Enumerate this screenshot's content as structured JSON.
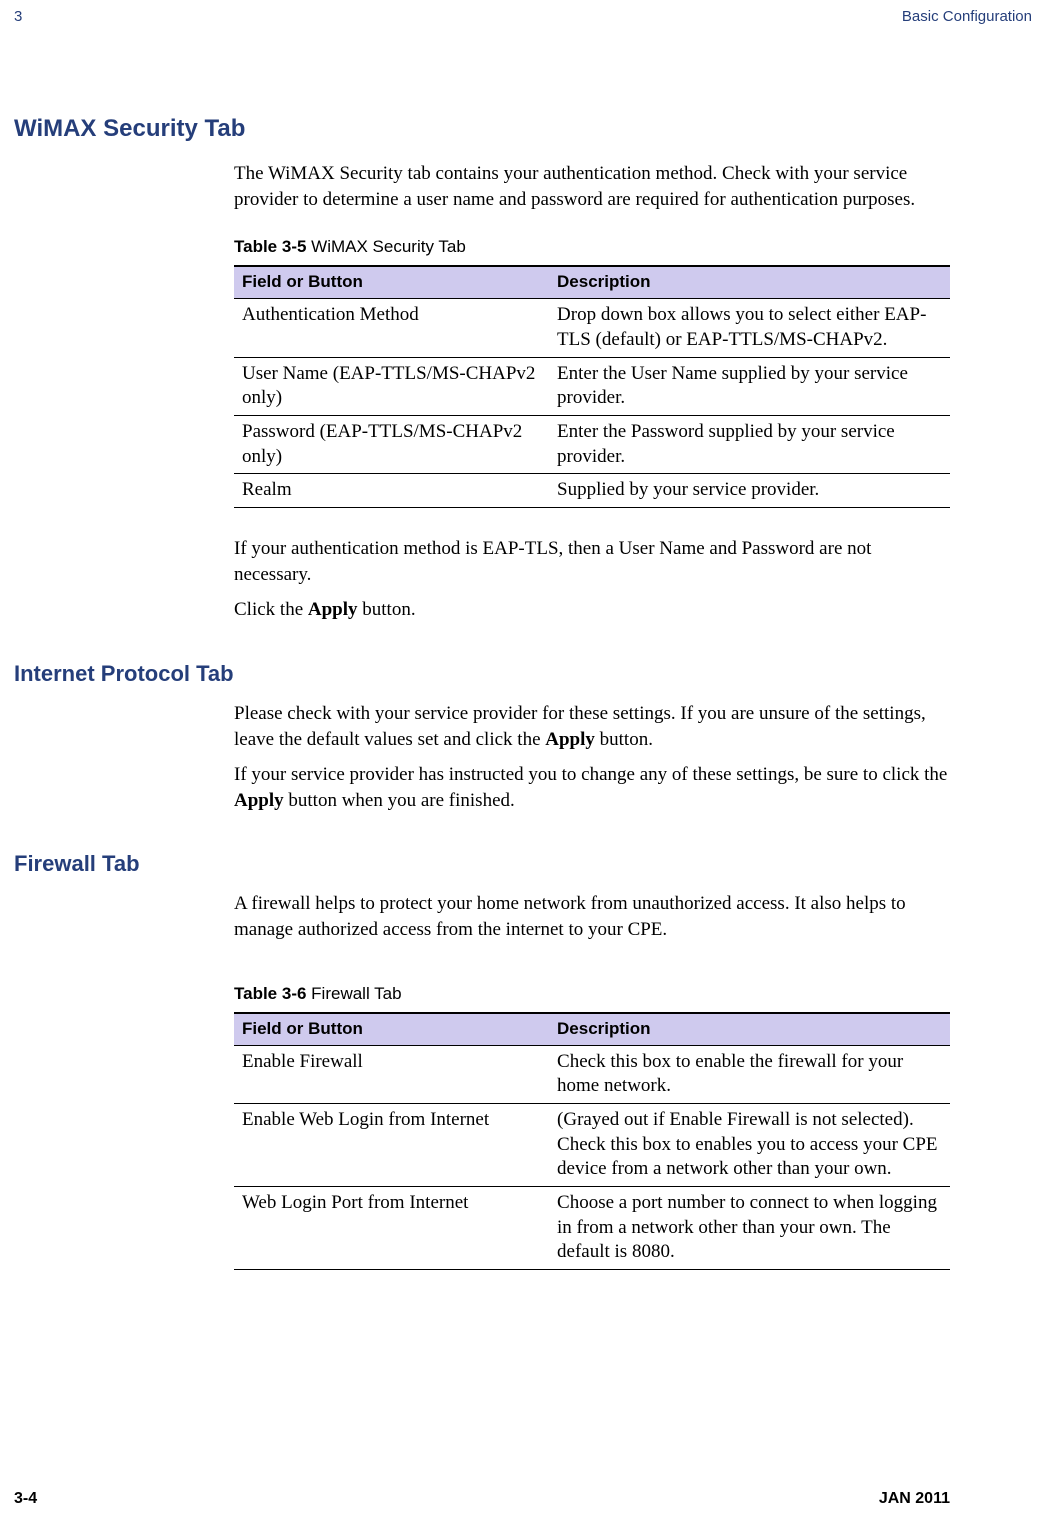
{
  "header": {
    "chapter_number": "3",
    "chapter_title": "Basic Configuration"
  },
  "section1": {
    "title": "WiMAX Security Tab",
    "intro": "The WiMAX Security tab contains your authentication method. Check with your service provider to determine a user name and password are required for authentication purposes.",
    "table_caption_bold": "Table 3-5",
    "table_caption_rest": " WiMAX Security Tab",
    "th1": "Field or Button",
    "th2": "Description",
    "rows": [
      {
        "f": "Authentication Method",
        "d": "Drop down box allows you to select either EAP-TLS (default) or EAP-TTLS/MS-CHAPv2."
      },
      {
        "f": "User Name (EAP-TTLS/MS-CHAPv2 only)",
        "d": "Enter the User Name supplied by your service provider."
      },
      {
        "f": "Password (EAP-TTLS/MS-CHAPv2 only)",
        "d": "Enter the Password supplied by your service provider."
      },
      {
        "f": "Realm",
        "d": "Supplied by your service provider."
      }
    ],
    "after_p1": "If your authentication method is EAP-TLS, then a User Name and Password are not necessary.",
    "after_p2_pre": "Click the ",
    "after_p2_bold": "Apply",
    "after_p2_post": " button."
  },
  "section2": {
    "title": "Internet Protocol Tab",
    "p1_pre": "Please check with your service provider for these settings. If you are unsure of the settings, leave the default values set and click the ",
    "p1_bold": "Apply",
    "p1_post": " button.",
    "p2_pre": "If your service provider has instructed you to change any of these settings, be sure to click the ",
    "p2_bold": "Apply",
    "p2_post": " button when you are finished."
  },
  "section3": {
    "title": "Firewall Tab",
    "intro": "A firewall helps to protect your home network from unauthorized access. It also helps to manage authorized access from the internet to your CPE.",
    "table_caption_bold": "Table 3-6",
    "table_caption_rest": " Firewall Tab",
    "th1": "Field or Button",
    "th2": "Description",
    "rows": [
      {
        "f": "Enable Firewall",
        "d": "Check this box to enable the firewall for your home network."
      },
      {
        "f": "Enable Web Login from Internet",
        "d": "(Grayed out if Enable Firewall is not selected).\nCheck this box to enables you to access your CPE device from a network other than your own."
      },
      {
        "f": "Web Login Port from Internet",
        "d": "Choose a port number to connect to when logging in from a network other than your own. The default is 8080."
      }
    ]
  },
  "footer": {
    "page_number": "3-4",
    "date": "JAN 2011"
  }
}
